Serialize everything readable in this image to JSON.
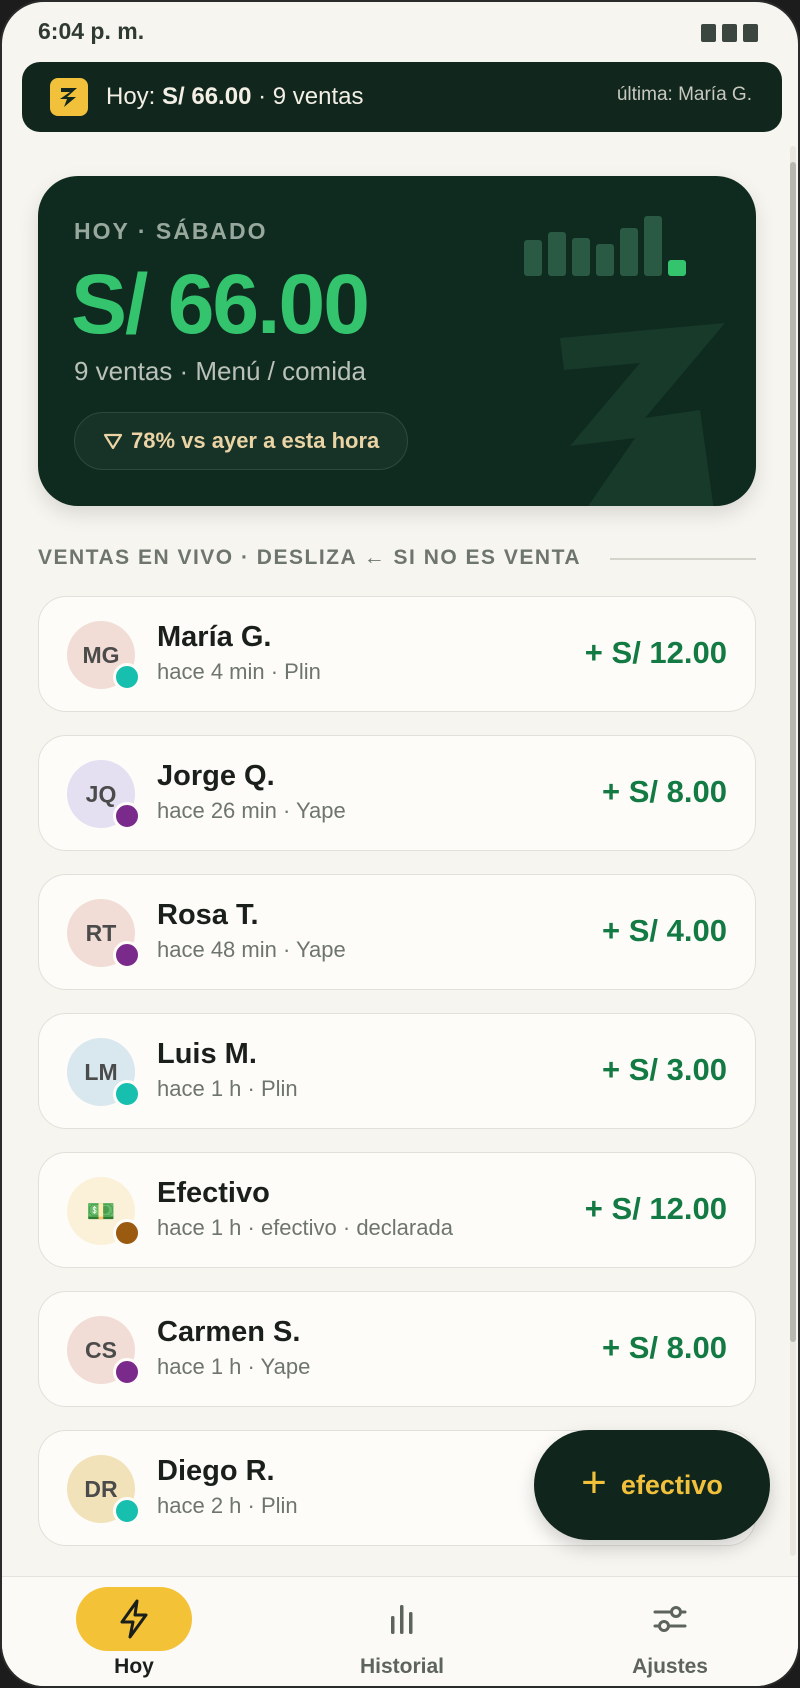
{
  "status_bar": {
    "time": "6:04 p. m."
  },
  "banner": {
    "prefix": "Hoy: ",
    "amount": "S/ 66.00",
    "sep": "·",
    "count": "9 ventas",
    "last": "última: María G."
  },
  "hero": {
    "eyebrow": "HOY · SÁBADO",
    "amount": "S/ 66.00",
    "subtitle": "9 ventas · Menú / comida",
    "compare_icon": "triangle-down-icon",
    "compare": "78% vs ayer a esta hora"
  },
  "section": {
    "title": "VENTAS EN VIVO · DESLIZA ← SI NO ES VENTA"
  },
  "sales": [
    {
      "initials": "MG",
      "name": "María G.",
      "meta": "hace 4 min · Plin",
      "amount": "+ S/ 12.00",
      "avatar_bg": "#f1ddd6",
      "dot": "#17bfae"
    },
    {
      "initials": "JQ",
      "name": "Jorge Q.",
      "meta": "hace 26 min · Yape",
      "amount": "+ S/ 8.00",
      "avatar_bg": "#e4dff1",
      "dot": "#7a2a8a"
    },
    {
      "initials": "RT",
      "name": "Rosa T.",
      "meta": "hace 48 min · Yape",
      "amount": "+ S/ 4.00",
      "avatar_bg": "#f1ddd6",
      "dot": "#7a2a8a"
    },
    {
      "initials": "LM",
      "name": "Luis M.",
      "meta": "hace 1 h · Plin",
      "amount": "+ S/ 3.00",
      "avatar_bg": "#d9e7ee",
      "dot": "#17bfae"
    },
    {
      "initials": "💵",
      "name": "Efectivo",
      "meta": "hace 1 h · efectivo · declarada",
      "amount": "+ S/ 12.00",
      "avatar_bg": "#fbf1d8",
      "dot": "#9a5a10"
    },
    {
      "initials": "CS",
      "name": "Carmen S.",
      "meta": "hace 1 h · Yape",
      "amount": "+ S/ 8.00",
      "avatar_bg": "#f1ddd6",
      "dot": "#7a2a8a"
    },
    {
      "initials": "DR",
      "name": "Diego R.",
      "meta": "hace 2 h · Plin",
      "amount": "",
      "avatar_bg": "#f1e2b9",
      "dot": "#17bfae"
    }
  ],
  "fab": {
    "icon": "plus-icon",
    "label": "efectivo"
  },
  "nav": [
    {
      "label": "Hoy",
      "icon": "bolt-icon",
      "active": true
    },
    {
      "label": "Historial",
      "icon": "bar-chart-icon",
      "active": false
    },
    {
      "label": "Ajustes",
      "icon": "sliders-icon",
      "active": false
    }
  ],
  "colors": {
    "background": "#f7f5ef",
    "dark_green": "#0f2b20",
    "accent_green": "#33c46d",
    "amount_green": "#137a43",
    "yellow": "#f2c13c"
  }
}
